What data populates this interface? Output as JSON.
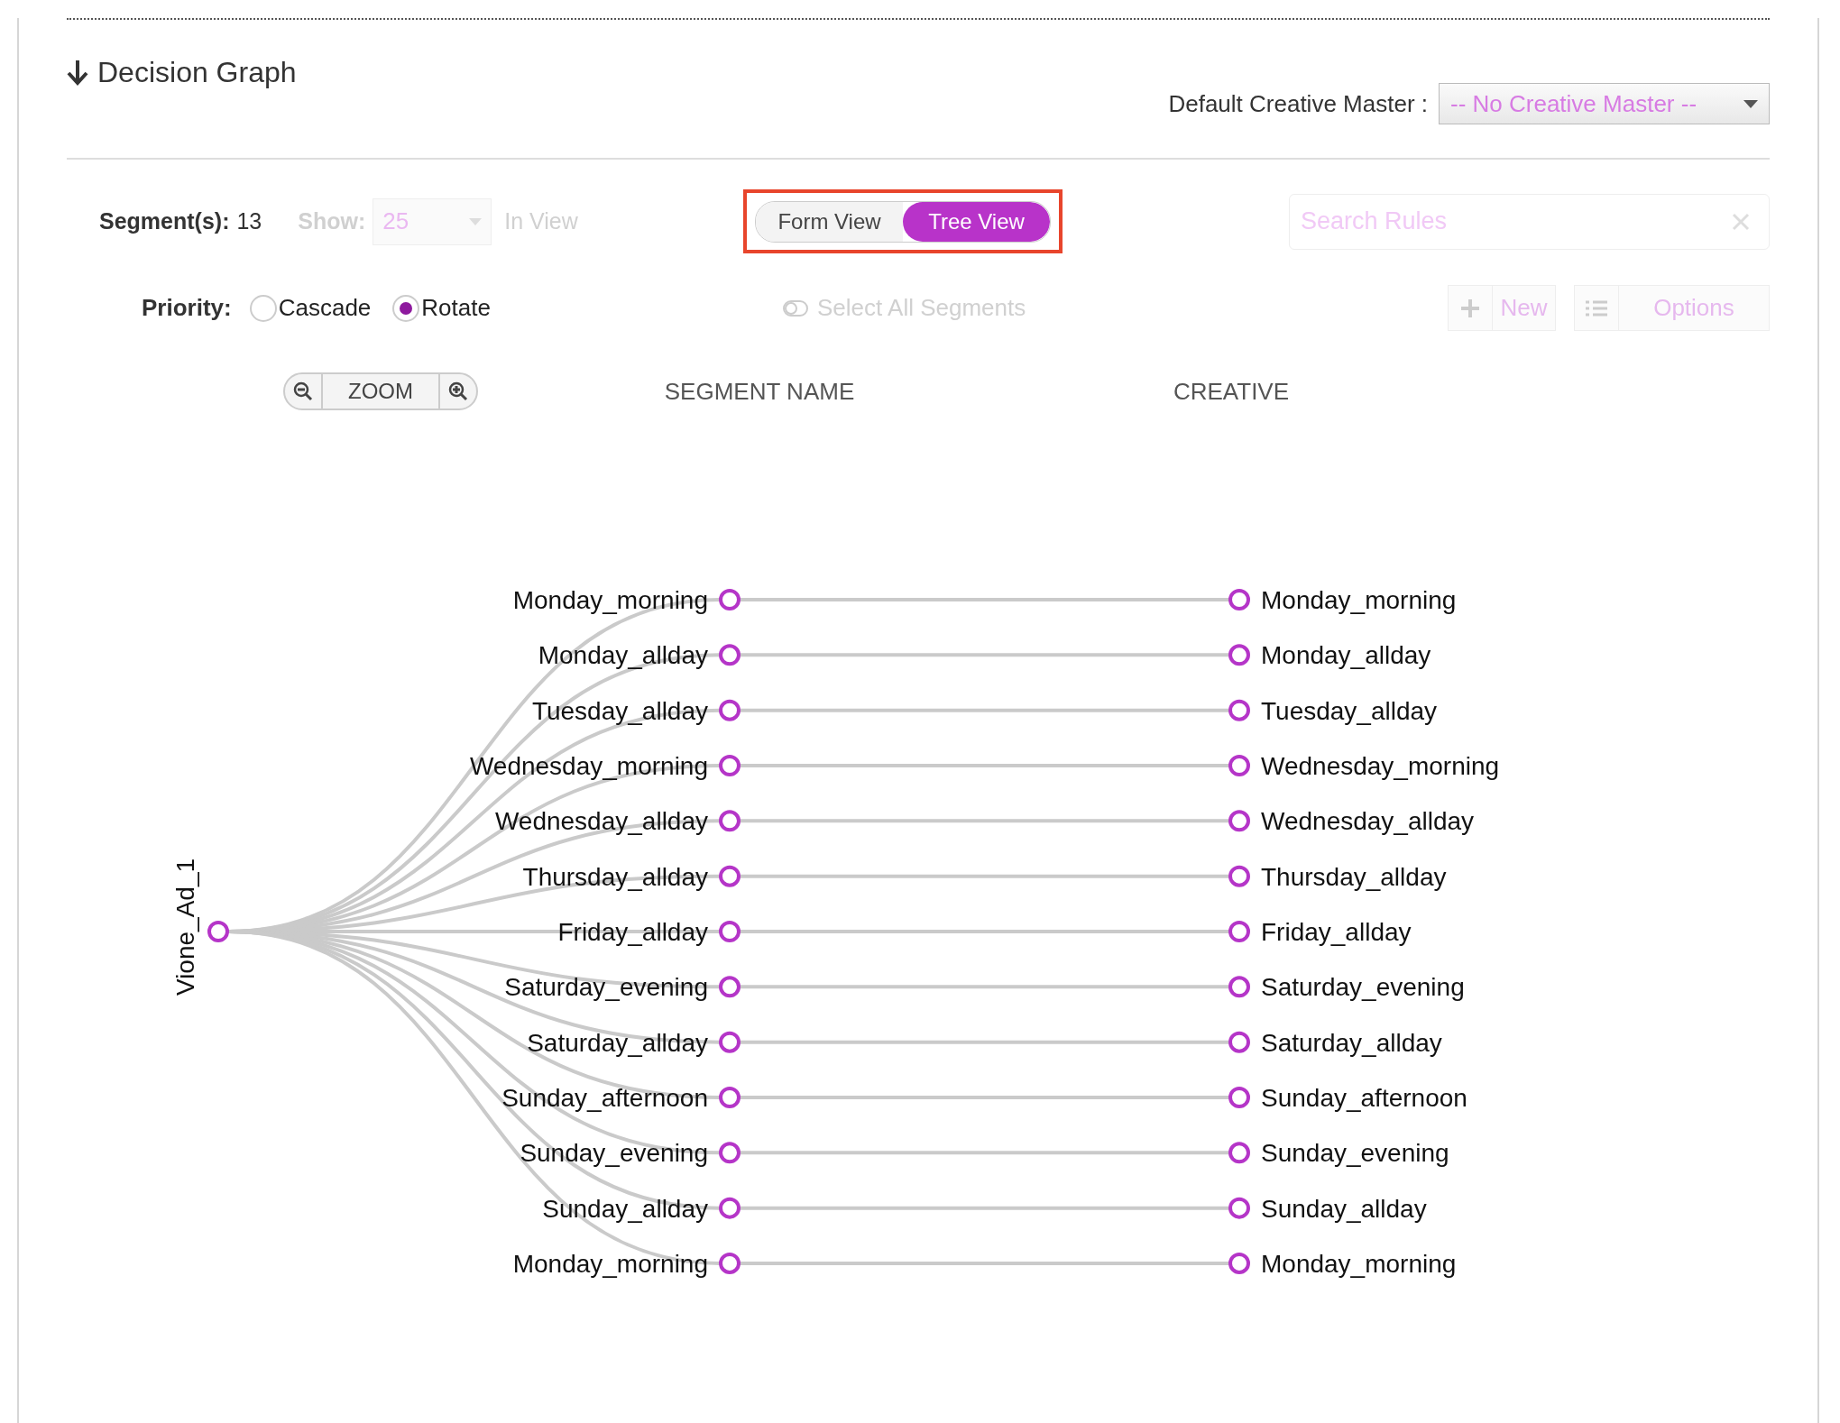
{
  "header": {
    "title": "Decision Graph"
  },
  "default_creative_master": {
    "label": "Default Creative Master :",
    "value": "-- No Creative Master --"
  },
  "toolbar": {
    "segments_label": "Segment(s):",
    "segments_count": "13",
    "show": {
      "label": "Show:",
      "value": "25",
      "suffix": "In View",
      "disabled": true
    },
    "views": [
      {
        "label": "Form View",
        "selected": false
      },
      {
        "label": "Tree View",
        "selected": true
      }
    ],
    "search": {
      "placeholder": "Search Rules"
    }
  },
  "priority": {
    "label": "Priority:",
    "options": [
      {
        "label": "Cascade",
        "selected": false
      },
      {
        "label": "Rotate",
        "selected": true
      }
    ]
  },
  "select_all": {
    "label": "Select All Segments",
    "disabled": true
  },
  "buttons": [
    {
      "kind": "new",
      "label": "New",
      "disabled": true
    },
    {
      "kind": "options",
      "label": "Options",
      "disabled": true
    }
  ],
  "zoom": {
    "label": "ZOOM"
  },
  "columns": [
    "SEGMENT NAME",
    "CREATIVE"
  ],
  "tree": {
    "root": "Vione_Ad_1",
    "children": [
      {
        "segment": "Monday_morning",
        "creative": "Monday_morning"
      },
      {
        "segment": "Monday_allday",
        "creative": "Monday_allday"
      },
      {
        "segment": "Tuesday_allday",
        "creative": "Tuesday_allday"
      },
      {
        "segment": "Wednesday_morning",
        "creative": "Wednesday_morning"
      },
      {
        "segment": "Wednesday_allday",
        "creative": "Wednesday_allday"
      },
      {
        "segment": "Thursday_allday",
        "creative": "Thursday_allday"
      },
      {
        "segment": "Friday_allday",
        "creative": "Friday_allday"
      },
      {
        "segment": "Saturday_evening",
        "creative": "Saturday_evening"
      },
      {
        "segment": "Saturday_allday",
        "creative": "Saturday_allday"
      },
      {
        "segment": "Sunday_afternoon",
        "creative": "Sunday_afternoon"
      },
      {
        "segment": "Sunday_evening",
        "creative": "Sunday_evening"
      },
      {
        "segment": "Sunday_allday",
        "creative": "Sunday_allday"
      },
      {
        "segment": "Monday_morning",
        "creative": "Monday_morning"
      }
    ]
  }
}
